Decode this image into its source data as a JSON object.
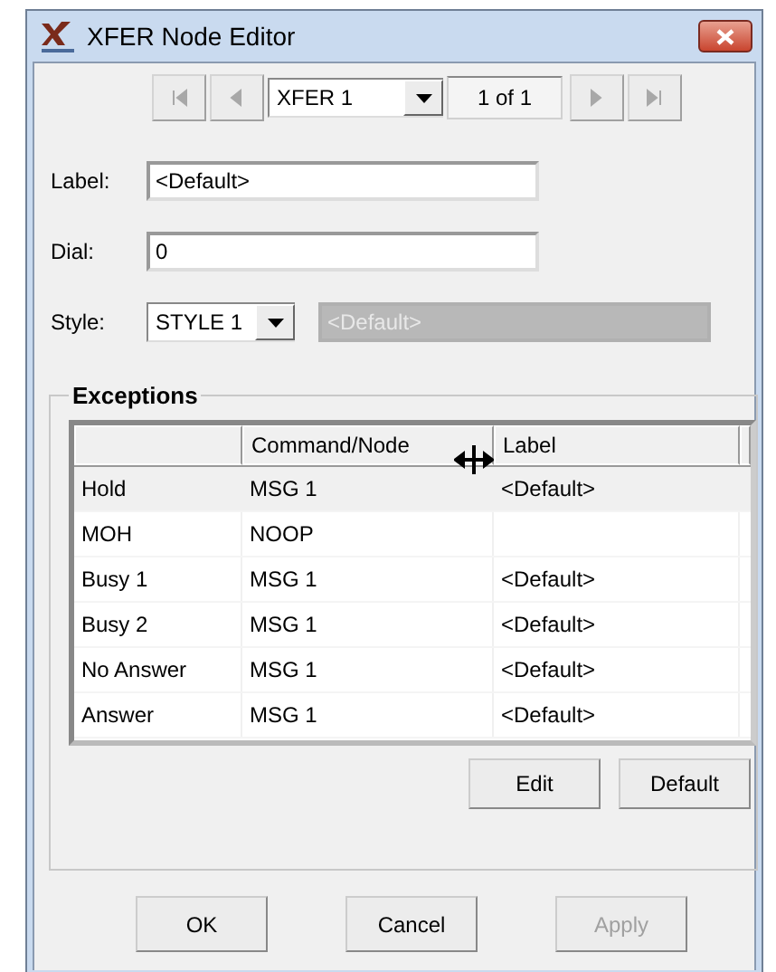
{
  "window": {
    "title": "XFER Node Editor"
  },
  "navigator": {
    "buttons": [
      {
        "kind": "first",
        "disabled": true
      },
      {
        "kind": "prev",
        "disabled": true
      },
      {
        "kind": "next",
        "disabled": true
      },
      {
        "kind": "last",
        "disabled": true
      }
    ],
    "record": "XFER 1",
    "count": "1 of 1"
  },
  "fields": [
    {
      "kind": "text",
      "label": "Label:",
      "value": "<Default>"
    },
    {
      "kind": "text",
      "label": "Dial:",
      "value": "0"
    },
    {
      "kind": "combo",
      "label": "Style:",
      "value": "STYLE 1",
      "extra": {
        "value": "<Default>",
        "disabled": true
      }
    }
  ],
  "exceptions": {
    "title": "Exceptions",
    "columns": [
      "Command/Node",
      "Label"
    ],
    "rows": [
      {
        "event": "Hold",
        "command": "MSG 1",
        "label": "<Default>",
        "selected": true
      },
      {
        "event": "MOH",
        "command": "NOOP",
        "selected": false
      },
      {
        "event": "Busy 1",
        "command": "MSG 1",
        "label": "<Default>",
        "selected": false
      },
      {
        "event": "Busy 2",
        "command": "MSG 1",
        "label": "<Default>",
        "selected": false
      },
      {
        "event": "No Answer",
        "command": "MSG 1",
        "label": "<Default>",
        "selected": false
      },
      {
        "event": "Answer",
        "command": "MSG 1",
        "label": "<Default>",
        "selected": false
      }
    ],
    "buttons": [
      "Edit",
      "Default"
    ]
  },
  "buttons": [
    {
      "label": "OK",
      "disabled": false
    },
    {
      "label": "Cancel",
      "disabled": false
    },
    {
      "label": "Apply",
      "disabled": true
    }
  ]
}
